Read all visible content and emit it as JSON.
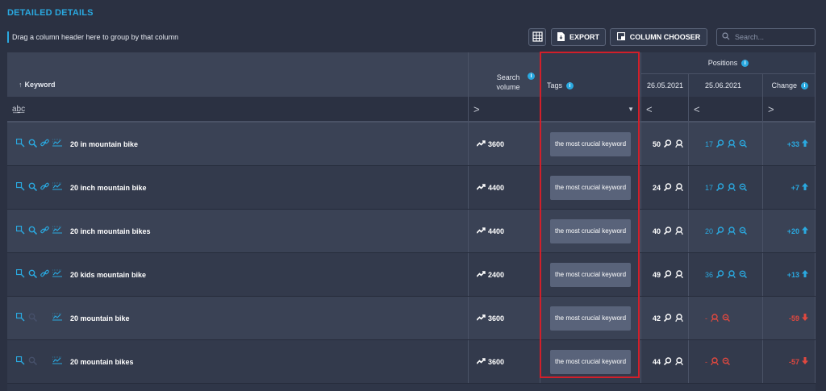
{
  "title": "DETAILED DETAILS",
  "group_hint": "Drag a column header here to group by that column",
  "toolbar": {
    "export_label": "EXPORT",
    "column_chooser_label": "COLUMN CHOOSER",
    "search_placeholder": "Search..."
  },
  "columns": {
    "keyword": "Keyword",
    "search_volume": "Search volume",
    "tags": "Tags",
    "positions": "Positions",
    "date1": "26.05.2021",
    "date2": "25.06.2021",
    "change": "Change"
  },
  "filters": {
    "keyword": "a͟b͟c",
    "search_volume": ">",
    "date1": "<",
    "date2": "<",
    "change": ">"
  },
  "rows": [
    {
      "keyword": "20 in mountain bike",
      "volume": "3600",
      "tag": "the most crucial keyword",
      "pos1": "50",
      "pos2": "17",
      "change": "+33",
      "direction": "up"
    },
    {
      "keyword": "20 inch mountain bike",
      "volume": "4400",
      "tag": "the most crucial keyword",
      "pos1": "24",
      "pos2": "17",
      "change": "+7",
      "direction": "up"
    },
    {
      "keyword": "20 inch mountain bikes",
      "volume": "4400",
      "tag": "the most crucial keyword",
      "pos1": "40",
      "pos2": "20",
      "change": "+20",
      "direction": "up"
    },
    {
      "keyword": "20 kids mountain bike",
      "volume": "2400",
      "tag": "the most crucial keyword",
      "pos1": "49",
      "pos2": "36",
      "change": "+13",
      "direction": "up"
    },
    {
      "keyword": "20 mountain bike",
      "volume": "3600",
      "tag": "the most crucial keyword",
      "pos1": "42",
      "pos2": "-",
      "change": "-59",
      "direction": "down"
    },
    {
      "keyword": "20 mountain bikes",
      "volume": "3600",
      "tag": "the most crucial keyword",
      "pos1": "44",
      "pos2": "-",
      "change": "-57",
      "direction": "down"
    }
  ],
  "colors": {
    "accent": "#2aa9e0",
    "negative": "#e0483f",
    "highlight_border": "#d21f2a",
    "tag_chip": "#59637a"
  }
}
